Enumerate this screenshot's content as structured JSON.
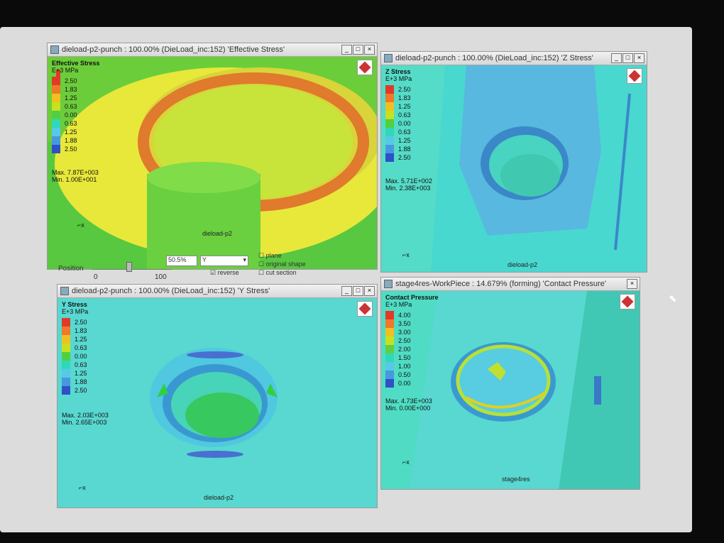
{
  "windows": [
    {
      "title": "dieload-p2-punch : 100.00% (DieLoad_inc:152) 'Effective Stress'",
      "legend_title": "Effective Stress",
      "unit": "E+3 MPa",
      "scale": [
        "2.50",
        "1.83",
        "1.25",
        "0.63",
        "0.00",
        "0.63",
        "1.25",
        "1.88",
        "2.50"
      ],
      "max_label": "Max.",
      "max_value": "7.87E+003",
      "min_label": "Min.",
      "min_value": "1.00E+001",
      "caption": "dieload-p2",
      "axis_label": "x"
    },
    {
      "title": "dieload-p2-punch : 100.00% (DieLoad_inc:152) 'Z Stress'",
      "legend_title": "Z Stress",
      "unit": "E+3 MPa",
      "scale": [
        "2.50",
        "1.83",
        "1.25",
        "0.63",
        "0.00",
        "0.63",
        "1.25",
        "1.88",
        "2.50"
      ],
      "max_label": "Max.",
      "max_value": "5.71E+002",
      "min_label": "Min.",
      "min_value": "2.38E+003",
      "caption": "dieload-p2",
      "axis_label": "x"
    },
    {
      "title": "dieload-p2-punch : 100.00% (DieLoad_inc:152) 'Y Stress'",
      "legend_title": "Y Stress",
      "unit": "E+3 MPa",
      "scale": [
        "2.50",
        "1.83",
        "1.25",
        "0.63",
        "0.00",
        "0.63",
        "1.25",
        "1.88",
        "2.50"
      ],
      "max_label": "Max.",
      "max_value": "2.03E+003",
      "min_label": "Min.",
      "min_value": "2.65E+003",
      "caption": "dieload-p2",
      "axis_label": "x"
    },
    {
      "title": "stage4res-WorkPiece : 14.679% (forming) 'Contact Pressure'",
      "legend_title": "Contact Pressure",
      "unit": "E+3 MPa",
      "scale": [
        "4.00",
        "3.50",
        "3.00",
        "2.50",
        "2.00",
        "1.50",
        "1.00",
        "0.50",
        "0.00"
      ],
      "max_label": "Max.",
      "max_value": "4.73E+003",
      "min_label": "Min.",
      "min_value": "0.00E+000",
      "caption": "stage4res",
      "axis_label": "x"
    }
  ],
  "controls": {
    "position_label": "Position",
    "slider_min": "0",
    "slider_max": "100",
    "percent_value": "50.5%",
    "axis_select": "Y",
    "reverse_label": "reverse",
    "plane_label": "plane",
    "original_shape_label": "original shape",
    "cut_section_label": "cut section"
  },
  "colors": {
    "stress_scale": [
      "#e03a2a",
      "#f07828",
      "#f0c020",
      "#c8e020",
      "#50d040",
      "#30d8b8",
      "#58c8e8",
      "#4898e0",
      "#3050c8"
    ],
    "pressure_scale": [
      "#e03a2a",
      "#f07828",
      "#f0c020",
      "#c8e020",
      "#60d040",
      "#30d8b8",
      "#58c8e8",
      "#4898e0",
      "#3050c8"
    ]
  }
}
